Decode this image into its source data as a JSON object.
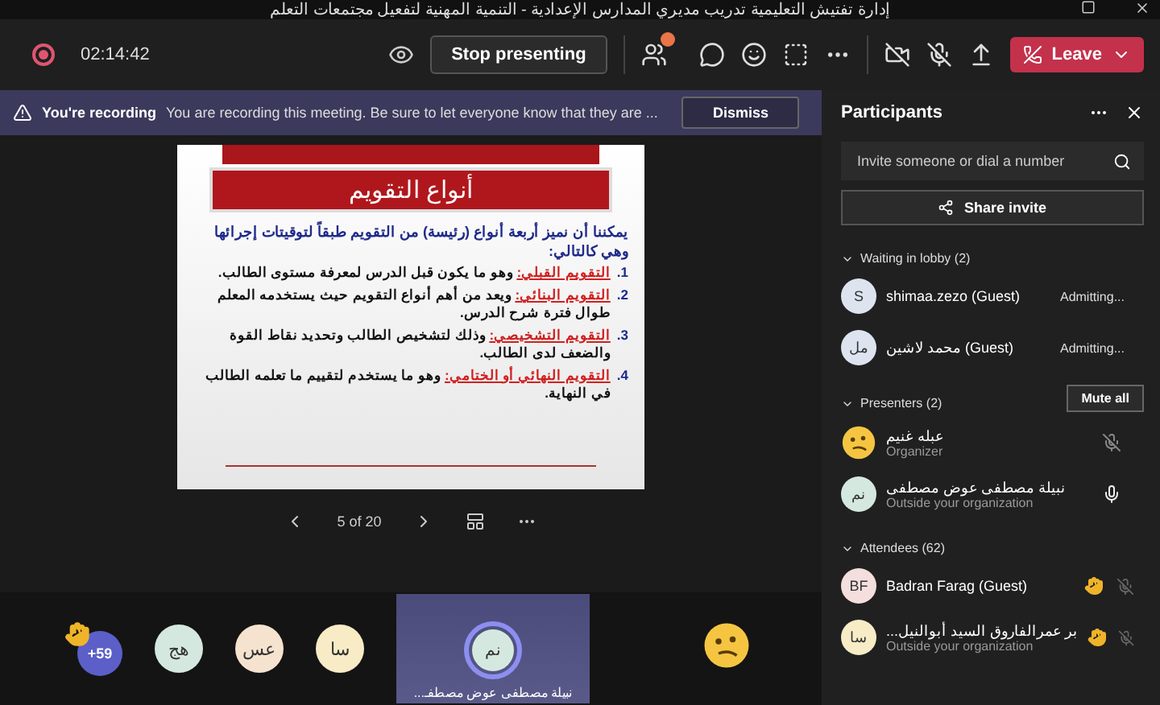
{
  "window": {
    "title": "إدارة تفتيش التعليمية تدريب مديري المدارس الإعدادية - التنمية المهنية لتفعيل مجتمعات التعلم"
  },
  "toolbar": {
    "timer": "02:14:42",
    "stop_presenting": "Stop presenting",
    "leave": "Leave"
  },
  "banner": {
    "title": "You're recording",
    "message": "You are recording this meeting. Be sure to let everyone know that they are ...",
    "dismiss": "Dismiss"
  },
  "slide": {
    "title": "أنواع التقويم",
    "intro": "يمكننا أن نميز أربعة أنواع (رئيسة) من التقويم طبقاً لتوقيتات إجرائها وهي كالتالي:",
    "items": [
      {
        "number": "1.",
        "term": "التقويم القبلي:",
        "text": "وهو ما يكون قبل الدرس لمعرفة مستوى الطالب."
      },
      {
        "number": "2.",
        "term": "التقويم البنائي:",
        "text": "ويعد من أهم أنواع التقويم حيث يستخدمه المعلم طوال فترة شرح الدرس."
      },
      {
        "number": "3.",
        "term": "التقويم التشخيصي:",
        "text": "وذلك لتشخيص الطالب وتحديد نقاط القوة والضعف لدى الطالب."
      },
      {
        "number": "4.",
        "term": "التقويم النهائي أو الختامي:",
        "text": "وهو ما يستخدم لتقييم ما تعلمه الطالب في النهاية."
      }
    ],
    "page": "5 of 20"
  },
  "gallery": {
    "overflow": "+59",
    "avatars": [
      {
        "initials": "سا",
        "color": "#f7ecc6"
      },
      {
        "initials": "عس",
        "color": "#f6e3cf"
      },
      {
        "initials": "هج",
        "color": "#d5e8df"
      }
    ],
    "tiles": [
      {
        "kind": "speaker",
        "initials": "نم",
        "color": "#d5e8df",
        "name": "نبيلة مصطفى عوض مصطفـ..."
      },
      {
        "kind": "emoji"
      }
    ]
  },
  "participants": {
    "title": "Participants",
    "search": {
      "placeholder": "Invite someone or dial a number"
    },
    "share_invite": "Share invite",
    "lobby": {
      "heading": "Waiting in lobby (2)",
      "expanded": true,
      "people": [
        {
          "initials": "S",
          "name": "shimaa.zezo (Guest)",
          "status": "Admitting..."
        },
        {
          "initials": "مل",
          "name": "محمد لاشين (Guest)",
          "status": "Admitting..."
        }
      ]
    },
    "presenters": {
      "heading": "Presenters (2)",
      "expanded": true,
      "mute_all": "Mute all",
      "people": [
        {
          "kind": "emoji",
          "name": "عبله غنيم",
          "subtitle": "Organizer",
          "muted": true
        },
        {
          "kind": "initials",
          "initials": "نم",
          "name": "نبيلة مصطفى عوض مصطفى",
          "subtitle": "Outside your organization",
          "muted": false
        }
      ]
    },
    "attendees": {
      "heading": "Attendees (62)",
      "expanded": true,
      "people": [
        {
          "initials": "BF",
          "name": "Badran Farag (Guest)",
          "hand_raised": true
        },
        {
          "initials": "سا",
          "name": "...بر عمرالفاروق السيد أبوالنيل",
          "subtitle": "Outside your organization",
          "hand_raised": true
        }
      ]
    }
  }
}
